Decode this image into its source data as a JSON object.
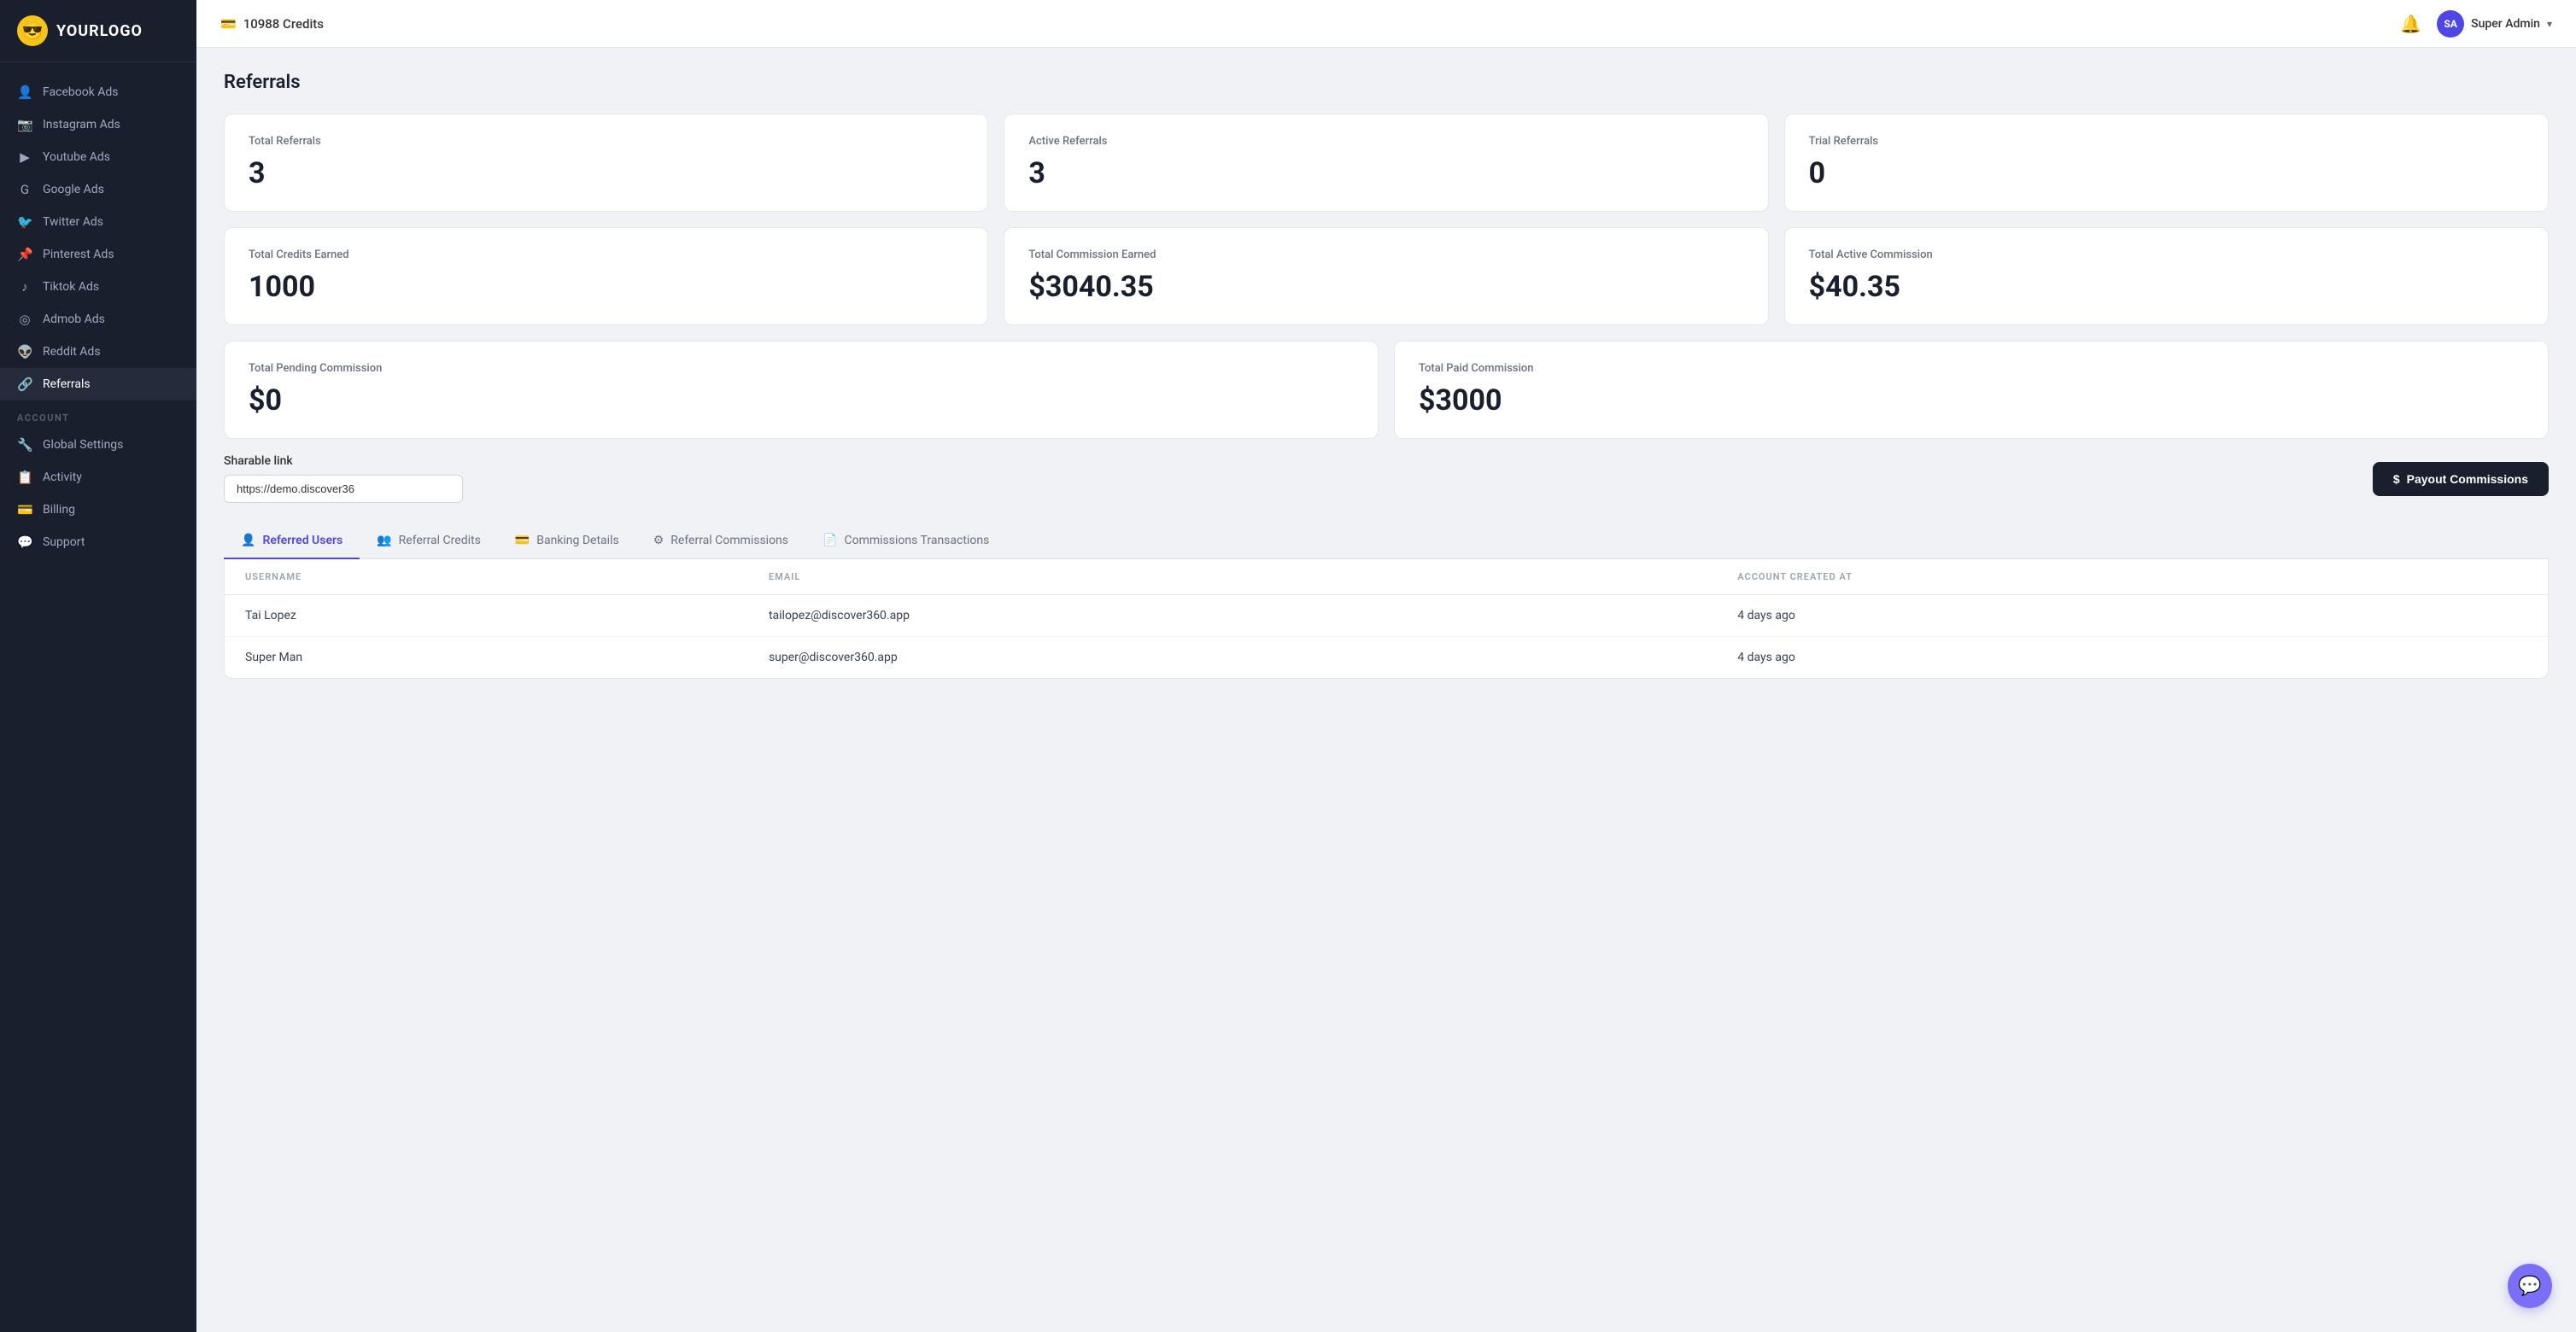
{
  "logo": {
    "icon": "😎",
    "text": "YOURLOGO"
  },
  "header": {
    "credits_icon": "💳",
    "credits_label": "10988 Credits",
    "notification_icon": "🔔",
    "user_initials": "SA",
    "user_name": "Super Admin",
    "chevron": "▾"
  },
  "sidebar": {
    "nav_items": [
      {
        "id": "facebook-ads",
        "icon": "👤",
        "label": "Facebook Ads"
      },
      {
        "id": "instagram-ads",
        "icon": "📷",
        "label": "Instagram Ads"
      },
      {
        "id": "youtube-ads",
        "icon": "▶",
        "label": "Youtube Ads"
      },
      {
        "id": "google-ads",
        "icon": "G",
        "label": "Google Ads"
      },
      {
        "id": "twitter-ads",
        "icon": "🐦",
        "label": "Twitter Ads"
      },
      {
        "id": "pinterest-ads",
        "icon": "📌",
        "label": "Pinterest Ads"
      },
      {
        "id": "tiktok-ads",
        "icon": "♪",
        "label": "Tiktok Ads"
      },
      {
        "id": "admob-ads",
        "icon": "◎",
        "label": "Admob Ads"
      },
      {
        "id": "reddit-ads",
        "icon": "👽",
        "label": "Reddit Ads"
      },
      {
        "id": "referrals",
        "icon": "🔗",
        "label": "Referrals",
        "active": true
      }
    ],
    "account_section_label": "ACCOUNT",
    "account_items": [
      {
        "id": "global-settings",
        "icon": "🔧",
        "label": "Global Settings"
      },
      {
        "id": "activity",
        "icon": "📋",
        "label": "Activity"
      },
      {
        "id": "billing",
        "icon": "💳",
        "label": "Billing"
      },
      {
        "id": "support",
        "icon": "💬",
        "label": "Support"
      }
    ]
  },
  "page": {
    "title": "Referrals"
  },
  "stats": {
    "row1": [
      {
        "label": "Total Referrals",
        "value": "3"
      },
      {
        "label": "Active Referrals",
        "value": "3"
      },
      {
        "label": "Trial Referrals",
        "value": "0"
      }
    ],
    "row2": [
      {
        "label": "Total Credits Earned",
        "value": "1000"
      },
      {
        "label": "Total Commission Earned",
        "value": "$3040.35"
      },
      {
        "label": "Total Active Commission",
        "value": "$40.35"
      }
    ],
    "row3": [
      {
        "label": "Total Pending Commission",
        "value": "$0"
      },
      {
        "label": "Total Paid Commission",
        "value": "$3000"
      }
    ]
  },
  "sharable_link": {
    "label": "Sharable link",
    "value": "https://demo.discover36",
    "placeholder": "https://demo.discover36"
  },
  "payout_button": {
    "icon": "$",
    "label": "Payout Commissions"
  },
  "tabs": [
    {
      "id": "referred-users",
      "icon": "👤",
      "label": "Referred Users",
      "active": true
    },
    {
      "id": "referral-credits",
      "icon": "👥",
      "label": "Referral Credits"
    },
    {
      "id": "banking-details",
      "icon": "💳",
      "label": "Banking Details"
    },
    {
      "id": "referral-commissions",
      "icon": "⚙",
      "label": "Referral Commissions"
    },
    {
      "id": "commissions-transactions",
      "icon": "📄",
      "label": "Commissions Transactions"
    }
  ],
  "table": {
    "columns": [
      {
        "id": "username",
        "label": "USERNAME"
      },
      {
        "id": "email",
        "label": "EMAIL"
      },
      {
        "id": "account_created_at",
        "label": "ACCOUNT CREATED AT"
      }
    ],
    "rows": [
      {
        "username": "Tai Lopez",
        "email": "tailopez@discover360.app",
        "account_created_at": "4 days ago"
      },
      {
        "username": "Super Man",
        "email": "super@discover360.app",
        "account_created_at": "4 days ago"
      }
    ]
  },
  "chat_bubble": {
    "icon": "💬"
  }
}
